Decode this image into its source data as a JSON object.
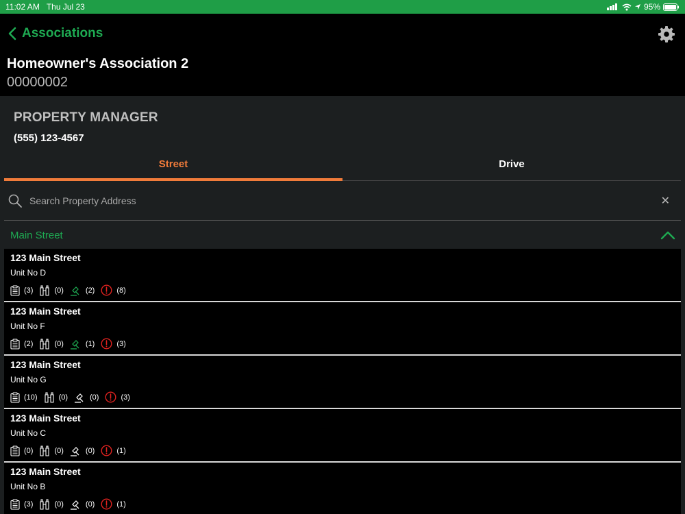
{
  "status": {
    "time": "11:02 AM",
    "date": "Thu Jul 23",
    "battery": "95%"
  },
  "nav": {
    "back_label": "Associations"
  },
  "association": {
    "name": "Homeowner's Association 2",
    "number": "00000002"
  },
  "property_manager": {
    "heading": "PROPERTY MANAGER",
    "phone": "(555) 123-4567"
  },
  "tabs": [
    {
      "label": "Street",
      "active": true
    },
    {
      "label": "Drive",
      "active": false
    }
  ],
  "search": {
    "placeholder": "Search Property Address",
    "value": ""
  },
  "group": {
    "label": "Main Street",
    "expanded": true
  },
  "colors": {
    "accent_green": "#1eaa52",
    "tab_orange": "#f07b3a",
    "alert_red": "#e0221f",
    "statusbar": "#1f9e47"
  },
  "properties": [
    {
      "address": "123 Main Street",
      "unit": "Unit No D",
      "notes": "(3)",
      "inspections": "(0)",
      "violations": "(2)",
      "alerts": "(8)",
      "violations_active": true
    },
    {
      "address": "123 Main Street",
      "unit": "Unit No F",
      "notes": "(2)",
      "inspections": "(0)",
      "violations": "(1)",
      "alerts": "(3)",
      "violations_active": true
    },
    {
      "address": "123 Main Street",
      "unit": "Unit No G",
      "notes": "(10)",
      "inspections": "(0)",
      "violations": "(0)",
      "alerts": "(3)",
      "violations_active": false
    },
    {
      "address": "123 Main Street",
      "unit": "Unit No C",
      "notes": "(0)",
      "inspections": "(0)",
      "violations": "(0)",
      "alerts": "(1)",
      "violations_active": false
    },
    {
      "address": "123 Main Street",
      "unit": "Unit No B",
      "notes": "(3)",
      "inspections": "(0)",
      "violations": "(0)",
      "alerts": "(1)",
      "violations_active": false
    }
  ]
}
